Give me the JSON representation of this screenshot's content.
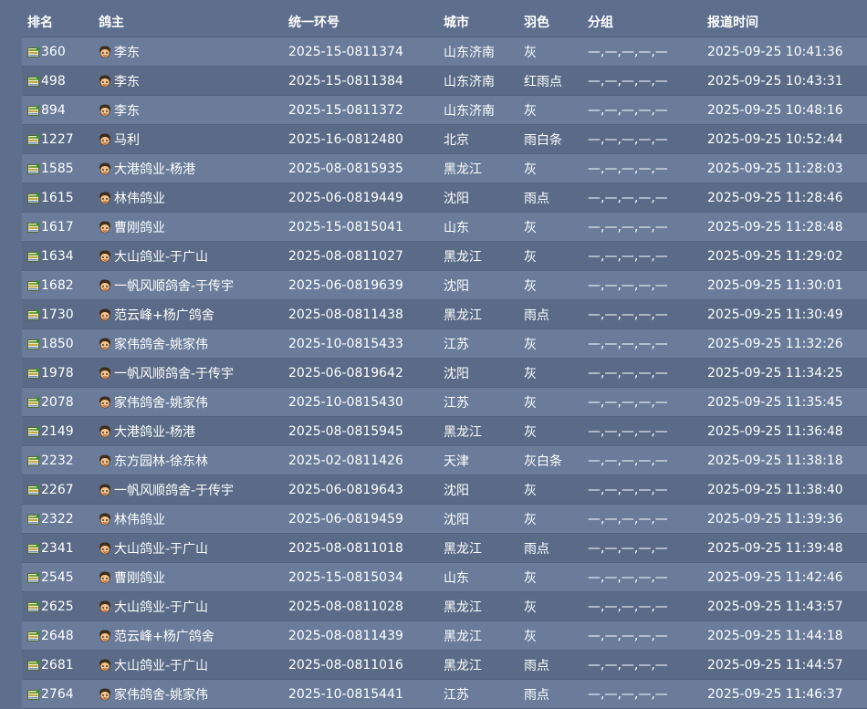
{
  "headers": {
    "rank": "排名",
    "owner": "鸽主",
    "ring": "统一环号",
    "city": "城市",
    "color": "羽色",
    "group": "分组",
    "time": "报道时间"
  },
  "icons": {
    "rank_icon": "book-icon",
    "owner_icon": "face-icon"
  },
  "rows": [
    {
      "rank": "360",
      "owner": "李东",
      "ring": "2025-15-0811374",
      "city": "山东济南",
      "color": "灰",
      "group": "—,—,—,—,—",
      "time": "2025-09-25 10:41:36"
    },
    {
      "rank": "498",
      "owner": "李东",
      "ring": "2025-15-0811384",
      "city": "山东济南",
      "color": "红雨点",
      "group": "—,—,—,—,—",
      "time": "2025-09-25 10:43:31"
    },
    {
      "rank": "894",
      "owner": "李东",
      "ring": "2025-15-0811372",
      "city": "山东济南",
      "color": "灰",
      "group": "—,—,—,—,—",
      "time": "2025-09-25 10:48:16"
    },
    {
      "rank": "1227",
      "owner": "马利",
      "ring": "2025-16-0812480",
      "city": "北京",
      "color": "雨白条",
      "group": "—,—,—,—,—",
      "time": "2025-09-25 10:52:44"
    },
    {
      "rank": "1585",
      "owner": "大港鸽业-杨港",
      "ring": "2025-08-0815935",
      "city": "黑龙江",
      "color": "灰",
      "group": "—,—,—,—,—",
      "time": "2025-09-25 11:28:03"
    },
    {
      "rank": "1615",
      "owner": "林伟鸽业",
      "ring": "2025-06-0819449",
      "city": "沈阳",
      "color": "雨点",
      "group": "—,—,—,—,—",
      "time": "2025-09-25 11:28:46"
    },
    {
      "rank": "1617",
      "owner": "曹刚鸽业",
      "ring": "2025-15-0815041",
      "city": "山东",
      "color": "灰",
      "group": "—,—,—,—,—",
      "time": "2025-09-25 11:28:48"
    },
    {
      "rank": "1634",
      "owner": "大山鸽业-于广山",
      "ring": "2025-08-0811027",
      "city": "黑龙江",
      "color": "灰",
      "group": "—,—,—,—,—",
      "time": "2025-09-25 11:29:02"
    },
    {
      "rank": "1682",
      "owner": "一帆风顺鸽舍-于传宇",
      "ring": "2025-06-0819639",
      "city": "沈阳",
      "color": "灰",
      "group": "—,—,—,—,—",
      "time": "2025-09-25 11:30:01"
    },
    {
      "rank": "1730",
      "owner": "范云峰+杨广鸽舍",
      "ring": "2025-08-0811438",
      "city": "黑龙江",
      "color": "雨点",
      "group": "—,—,—,—,—",
      "time": "2025-09-25 11:30:49"
    },
    {
      "rank": "1850",
      "owner": "家伟鸽舍-姚家伟",
      "ring": "2025-10-0815433",
      "city": "江苏",
      "color": "灰",
      "group": "—,—,—,—,—",
      "time": "2025-09-25 11:32:26"
    },
    {
      "rank": "1978",
      "owner": "一帆风顺鸽舍-于传宇",
      "ring": "2025-06-0819642",
      "city": "沈阳",
      "color": "灰",
      "group": "—,—,—,—,—",
      "time": "2025-09-25 11:34:25"
    },
    {
      "rank": "2078",
      "owner": "家伟鸽舍-姚家伟",
      "ring": "2025-10-0815430",
      "city": "江苏",
      "color": "灰",
      "group": "—,—,—,—,—",
      "time": "2025-09-25 11:35:45"
    },
    {
      "rank": "2149",
      "owner": "大港鸽业-杨港",
      "ring": "2025-08-0815945",
      "city": "黑龙江",
      "color": "灰",
      "group": "—,—,—,—,—",
      "time": "2025-09-25 11:36:48"
    },
    {
      "rank": "2232",
      "owner": "东方园林-徐东林",
      "ring": "2025-02-0811426",
      "city": "天津",
      "color": "灰白条",
      "group": "—,—,—,—,—",
      "time": "2025-09-25 11:38:18"
    },
    {
      "rank": "2267",
      "owner": "一帆风顺鸽舍-于传宇",
      "ring": "2025-06-0819643",
      "city": "沈阳",
      "color": "灰",
      "group": "—,—,—,—,—",
      "time": "2025-09-25 11:38:40"
    },
    {
      "rank": "2322",
      "owner": "林伟鸽业",
      "ring": "2025-06-0819459",
      "city": "沈阳",
      "color": "灰",
      "group": "—,—,—,—,—",
      "time": "2025-09-25 11:39:36"
    },
    {
      "rank": "2341",
      "owner": "大山鸽业-于广山",
      "ring": "2025-08-0811018",
      "city": "黑龙江",
      "color": "雨点",
      "group": "—,—,—,—,—",
      "time": "2025-09-25 11:39:48"
    },
    {
      "rank": "2545",
      "owner": "曹刚鸽业",
      "ring": "2025-15-0815034",
      "city": "山东",
      "color": "灰",
      "group": "—,—,—,—,—",
      "time": "2025-09-25 11:42:46"
    },
    {
      "rank": "2625",
      "owner": "大山鸽业-于广山",
      "ring": "2025-08-0811028",
      "city": "黑龙江",
      "color": "灰",
      "group": "—,—,—,—,—",
      "time": "2025-09-25 11:43:57"
    },
    {
      "rank": "2648",
      "owner": "范云峰+杨广鸽舍",
      "ring": "2025-08-0811439",
      "city": "黑龙江",
      "color": "灰",
      "group": "—,—,—,—,—",
      "time": "2025-09-25 11:44:18"
    },
    {
      "rank": "2681",
      "owner": "大山鸽业-于广山",
      "ring": "2025-08-0811016",
      "city": "黑龙江",
      "color": "雨点",
      "group": "—,—,—,—,—",
      "time": "2025-09-25 11:44:57"
    },
    {
      "rank": "2764",
      "owner": "家伟鸽舍-姚家伟",
      "ring": "2025-10-0815441",
      "city": "江苏",
      "color": "雨点",
      "group": "—,—,—,—,—",
      "time": "2025-09-25 11:46:37"
    }
  ]
}
